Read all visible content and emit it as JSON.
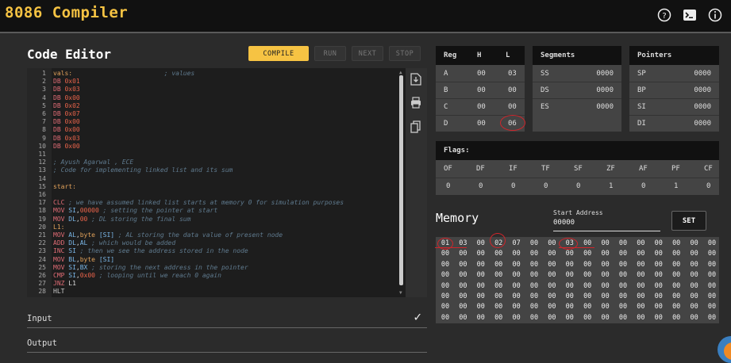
{
  "app": {
    "title": "8086 Compiler"
  },
  "header_icons": [
    "help-icon",
    "terminal-icon",
    "info-icon"
  ],
  "editor": {
    "title": "Code Editor",
    "buttons": {
      "compile": "COMPILE",
      "run": "RUN",
      "next": "NEXT",
      "stop": "STOP"
    },
    "lines": [
      [
        [
          "vals:",
          "lbl"
        ],
        [
          "                        ; values",
          "cm"
        ]
      ],
      [
        [
          "DB ",
          "kw"
        ],
        [
          "0x01",
          "num"
        ]
      ],
      [
        [
          "DB ",
          "kw"
        ],
        [
          "0x03",
          "num"
        ]
      ],
      [
        [
          "DB ",
          "kw"
        ],
        [
          "0x00",
          "num"
        ]
      ],
      [
        [
          "DB ",
          "kw"
        ],
        [
          "0x02",
          "num"
        ]
      ],
      [
        [
          "DB ",
          "kw"
        ],
        [
          "0x07",
          "num"
        ]
      ],
      [
        [
          "DB ",
          "kw"
        ],
        [
          "0x00",
          "num"
        ]
      ],
      [
        [
          "DB ",
          "kw"
        ],
        [
          "0x00",
          "num"
        ]
      ],
      [
        [
          "DB ",
          "kw"
        ],
        [
          "0x03",
          "num"
        ]
      ],
      [
        [
          "DB ",
          "kw"
        ],
        [
          "0x00",
          "num"
        ]
      ],
      [],
      [
        [
          "; Ayush Agarwal , ECE",
          "cm"
        ]
      ],
      [
        [
          "; Code for implementing linked list and its sum",
          "cm"
        ]
      ],
      [],
      [
        [
          "start:",
          "lbl"
        ]
      ],
      [],
      [
        [
          "CLC",
          "kw"
        ],
        [
          " ; we have assumed linked list starts at memory 0 for simulation purposes",
          "cm"
        ]
      ],
      [
        [
          "MOV ",
          "kw"
        ],
        [
          "SI",
          "reg"
        ],
        [
          ",",
          "w"
        ],
        [
          "00000",
          "num"
        ],
        [
          " ; setting the pointer at start",
          "cm"
        ]
      ],
      [
        [
          "MOV ",
          "kw"
        ],
        [
          "DL",
          "reg"
        ],
        [
          ",",
          "w"
        ],
        [
          "00",
          "num"
        ],
        [
          " ; DL storing the final sum",
          "cm"
        ]
      ],
      [
        [
          "L1:",
          "lbl"
        ]
      ],
      [
        [
          "MOV ",
          "kw"
        ],
        [
          "AL",
          "reg"
        ],
        [
          ",",
          "w"
        ],
        [
          "byte",
          "txt"
        ],
        [
          " [SI]",
          "reg"
        ],
        [
          " ; AL storing the data value of present node",
          "cm"
        ]
      ],
      [
        [
          "ADD ",
          "kw"
        ],
        [
          "DL",
          "reg"
        ],
        [
          ",",
          "w"
        ],
        [
          "AL",
          "reg"
        ],
        [
          " ; which would be added",
          "cm"
        ]
      ],
      [
        [
          "INC ",
          "kw"
        ],
        [
          "SI",
          "reg"
        ],
        [
          " ; then we see the address stored in the node",
          "cm"
        ]
      ],
      [
        [
          "MOV ",
          "kw"
        ],
        [
          "BL",
          "reg"
        ],
        [
          ",",
          "w"
        ],
        [
          "byte",
          "txt"
        ],
        [
          " [SI]",
          "reg"
        ]
      ],
      [
        [
          "MOV ",
          "kw"
        ],
        [
          "SI",
          "reg"
        ],
        [
          ",",
          "w"
        ],
        [
          "BX",
          "reg"
        ],
        [
          " ; storing the next address in the pointer",
          "cm"
        ]
      ],
      [
        [
          "CMP ",
          "kw"
        ],
        [
          "SI",
          "reg"
        ],
        [
          ",",
          "w"
        ],
        [
          "0x00",
          "num"
        ],
        [
          " ; looping until we reach 0 again",
          "cm"
        ]
      ],
      [
        [
          "JNZ ",
          "kw"
        ],
        [
          "L1",
          "w"
        ]
      ],
      [
        [
          "HLT",
          "hlt"
        ]
      ]
    ]
  },
  "sections": {
    "input": "Input",
    "output": "Output"
  },
  "registers": {
    "headers": [
      "Reg",
      "H",
      "L"
    ],
    "rows": [
      [
        "A",
        "00",
        "03"
      ],
      [
        "B",
        "00",
        "00"
      ],
      [
        "C",
        "00",
        "00"
      ],
      [
        "D",
        "00",
        "06"
      ]
    ]
  },
  "segments": {
    "title": "Segments",
    "rows": [
      [
        "SS",
        "0000"
      ],
      [
        "DS",
        "0000"
      ],
      [
        "ES",
        "0000"
      ]
    ]
  },
  "pointers": {
    "title": "Pointers",
    "rows": [
      [
        "SP",
        "0000"
      ],
      [
        "BP",
        "0000"
      ],
      [
        "SI",
        "0000"
      ],
      [
        "DI",
        "0000"
      ]
    ]
  },
  "flags": {
    "title": "Flags:",
    "names": [
      "OF",
      "DF",
      "IF",
      "TF",
      "SF",
      "ZF",
      "AF",
      "PF",
      "CF"
    ],
    "values": [
      "0",
      "0",
      "0",
      "0",
      "0",
      "1",
      "0",
      "1",
      "0"
    ]
  },
  "memory": {
    "title": "Memory",
    "start_label": "Start Address",
    "start_value": "00000",
    "set_label": "SET",
    "first_row": [
      "01",
      "03",
      "00",
      "02",
      "07",
      "00",
      "00",
      "03",
      "00",
      "00",
      "00",
      "00",
      "00",
      "00",
      "00",
      "00"
    ],
    "row_count": 8
  }
}
